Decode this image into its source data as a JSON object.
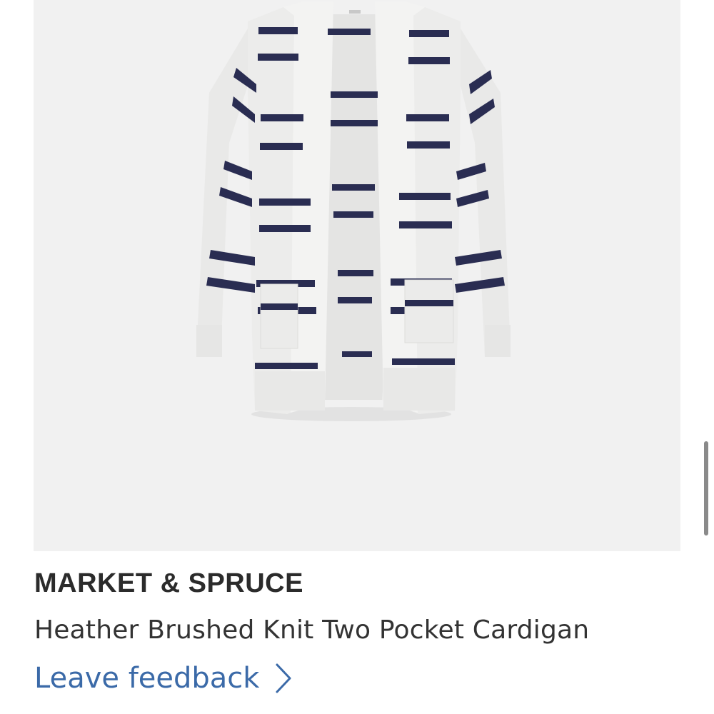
{
  "product": {
    "brand": "MARKET & SPRUCE",
    "name": "Heather Brushed Knit Two Pocket Cardigan",
    "feedback_label": "Leave feedback",
    "image_icon": "cardigan-product-photo"
  },
  "colors": {
    "image_background": "#f1f1f1",
    "knit_base": "#ebebea",
    "stripe": "#2a2d52",
    "link": "#3b6aa8",
    "brand_text": "#2b2b2b"
  }
}
